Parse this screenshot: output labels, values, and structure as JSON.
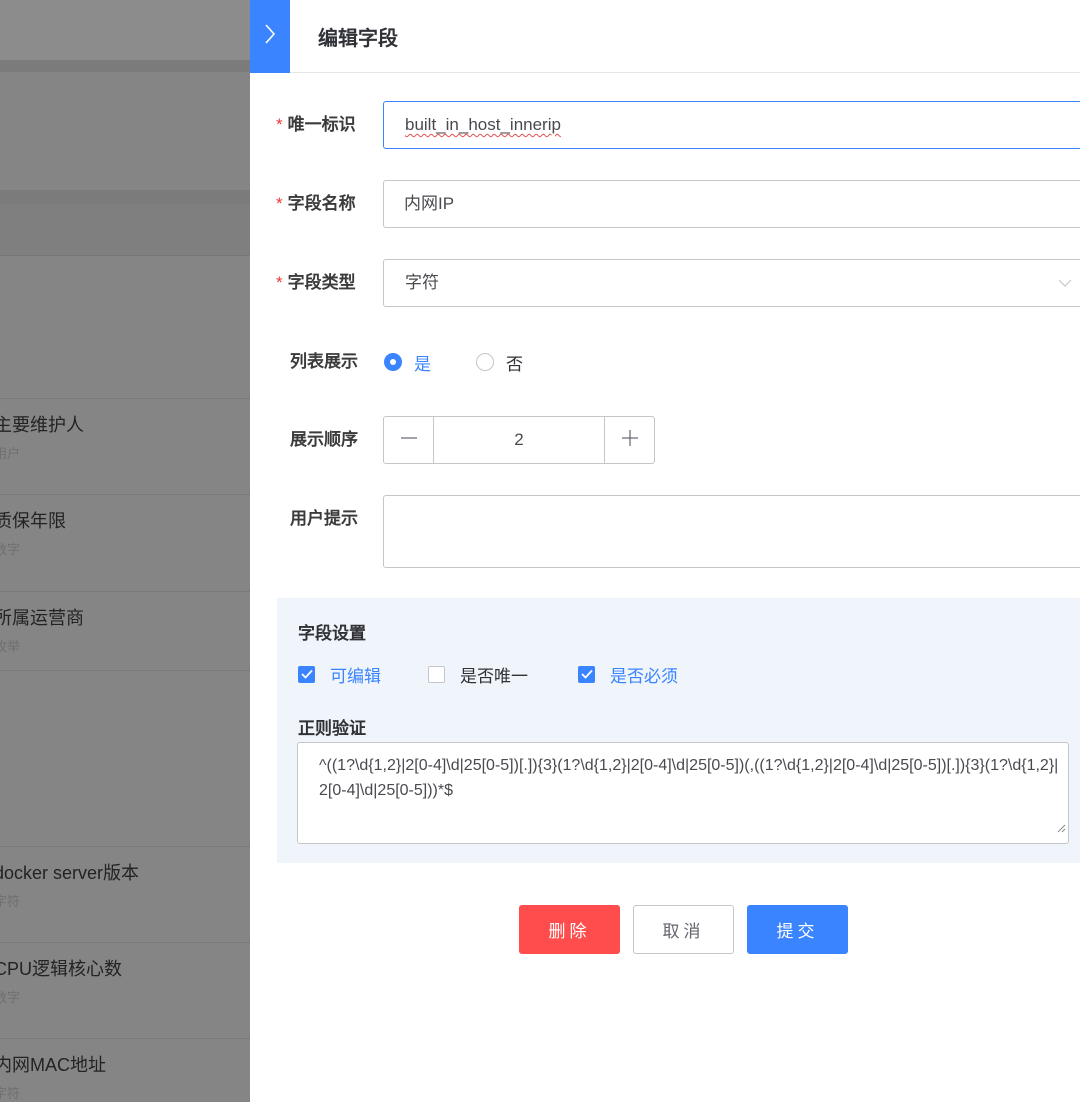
{
  "background": {
    "list_items": [
      {
        "title": "主要维护人",
        "subtitle": "用户"
      },
      {
        "title": "质保年限",
        "subtitle": "数字"
      },
      {
        "title": "所属运营商",
        "subtitle": "枚举"
      },
      {
        "title": "docker server版本",
        "subtitle": "字符"
      },
      {
        "title": "CPU逻辑核心数",
        "subtitle": "数字"
      },
      {
        "title": "内网MAC地址",
        "subtitle": "字符"
      }
    ]
  },
  "drawer": {
    "title": "编辑字段",
    "collapse_icon": "chevron-right-icon"
  },
  "form": {
    "required_mark": "*",
    "unique_id": {
      "label": "唯一标识",
      "value": "built_in_host_innerip"
    },
    "field_name": {
      "label": "字段名称",
      "value": "内网IP"
    },
    "field_type": {
      "label": "字段类型",
      "value": "字符"
    },
    "list_display": {
      "label": "列表展示",
      "options": [
        "是",
        "否"
      ],
      "selected": "是"
    },
    "display_order": {
      "label": "展示顺序",
      "value": "2"
    },
    "user_hint": {
      "label": "用户提示",
      "value": ""
    }
  },
  "settings": {
    "title": "字段设置",
    "checkboxes": [
      {
        "label": "可编辑",
        "checked": true
      },
      {
        "label": "是否唯一",
        "checked": false
      },
      {
        "label": "是否必须",
        "checked": true
      }
    ],
    "regex_title": "正则验证",
    "regex_value": "^((1?\\d{1,2}|2[0-4]\\d|25[0-5])[.]){3}(1?\\d{1,2}|2[0-4]\\d|25[0-5])(,((1?\\d{1,2}|2[0-4]\\d|25[0-5])[.]){3}(1?\\d{1,2}|2[0-4]\\d|25[0-5]))*$"
  },
  "actions": {
    "delete": "删除",
    "cancel": "取消",
    "submit": "提交"
  },
  "colors": {
    "primary": "#3a84ff",
    "danger": "#ff4c4c",
    "required": "#ea3636"
  }
}
